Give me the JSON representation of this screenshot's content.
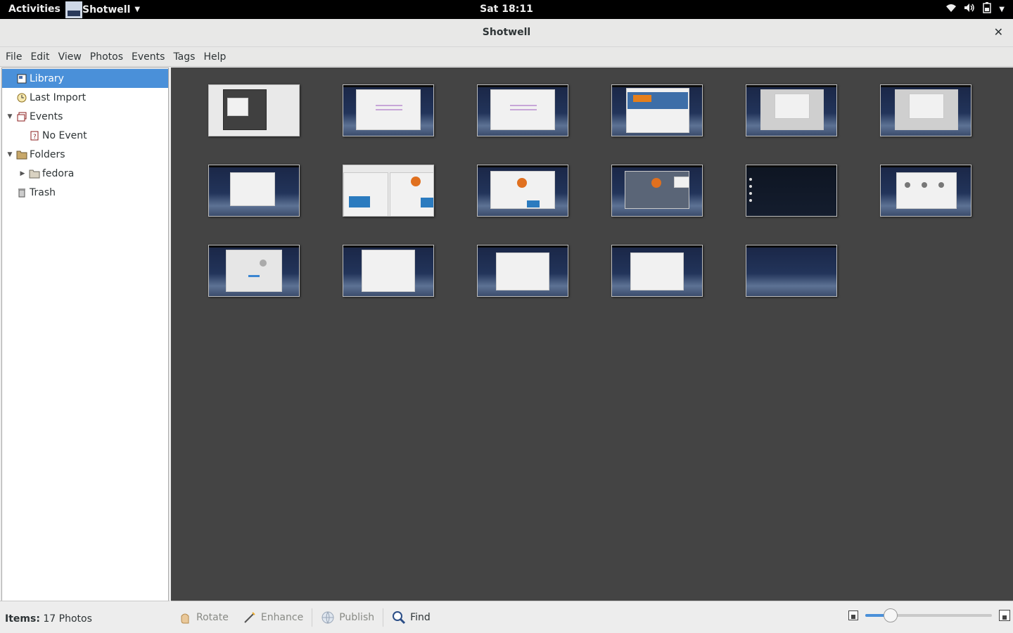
{
  "topbar": {
    "activities": "Activities",
    "app_name": "Shotwell",
    "clock": "Sat 18:11",
    "status_icons": [
      "wifi-icon",
      "volume-icon",
      "battery-icon",
      "menu-caret-icon"
    ]
  },
  "window": {
    "title": "Shotwell"
  },
  "menubar": {
    "items": [
      "File",
      "Edit",
      "View",
      "Photos",
      "Events",
      "Tags",
      "Help"
    ]
  },
  "sidebar": {
    "items": [
      {
        "label": "Library",
        "icon": "library-icon",
        "selected": true
      },
      {
        "label": "Last Import",
        "icon": "clock-icon"
      },
      {
        "label": "Events",
        "icon": "events-icon",
        "expanded": true
      },
      {
        "label": "No Event",
        "icon": "no-event-icon"
      },
      {
        "label": "Folders",
        "icon": "folder-icon",
        "expanded": true
      },
      {
        "label": "fedora",
        "icon": "folder-icon",
        "expanded": false
      },
      {
        "label": "Trash",
        "icon": "trash-icon"
      }
    ]
  },
  "status": {
    "items_label": "Items:",
    "items_value": "17 Photos"
  },
  "toolbar": {
    "rotate": "Rotate",
    "enhance": "Enhance",
    "publish": "Publish",
    "find": "Find",
    "zoom_level": 0.2
  },
  "photos_count": 17,
  "colors": {
    "selection": "#4a90d9",
    "viewer_bg": "#444444"
  }
}
